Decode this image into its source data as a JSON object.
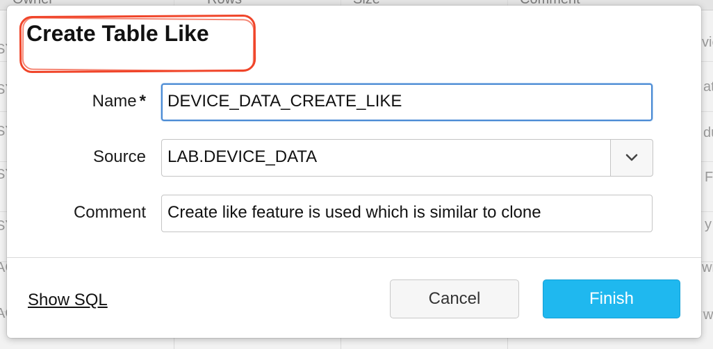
{
  "background": {
    "column_headers": [
      "Owner",
      "Rows",
      "Size",
      "Comment"
    ],
    "left_edge_fragments": [
      "SY",
      "SY",
      "SY",
      "SY",
      "SY",
      "AC",
      "AC"
    ],
    "right_edge_fragments": [
      "vic",
      "at",
      "du",
      "F",
      "y",
      "wit",
      "w"
    ]
  },
  "dialog": {
    "title": "Create Table Like",
    "fields": {
      "name": {
        "label": "Name",
        "required_mark": "*",
        "value": "DEVICE_DATA_CREATE_LIKE"
      },
      "source": {
        "label": "Source",
        "value": "LAB.DEVICE_DATA"
      },
      "comment": {
        "label": "Comment",
        "value": "Create like feature is used which is similar to clone"
      }
    },
    "footer": {
      "show_sql": "Show SQL",
      "cancel": "Cancel",
      "finish": "Finish"
    }
  },
  "colors": {
    "accent": "#1fb8ef",
    "highlight": "#f0452a",
    "focus_border": "#4a8ad4"
  },
  "icons": {
    "source_dropdown": "chevron-down-icon"
  }
}
